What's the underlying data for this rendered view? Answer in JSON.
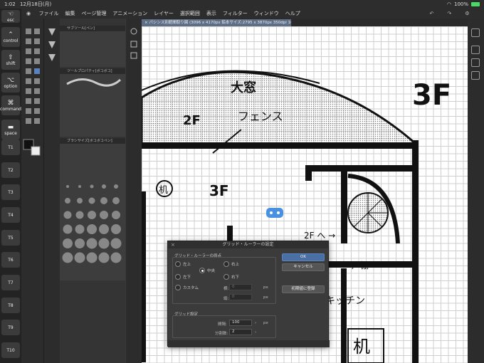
{
  "status_bar": {
    "time": "1:02",
    "date": "12月18日(月)",
    "battery": "100%"
  },
  "menu": {
    "items": [
      "ファイル",
      "編集",
      "ページ管理",
      "アニメーション",
      "レイヤー",
      "選択範囲",
      "表示",
      "フィルター",
      "ウィンドウ",
      "ヘルプ"
    ]
  },
  "left_keys": {
    "esc": "esc",
    "control": "control",
    "shift": "shift",
    "option": "option",
    "command": "command",
    "space": "space",
    "t_keys": [
      "T1",
      "T2",
      "T3",
      "T4",
      "T5",
      "T6",
      "T7",
      "T8",
      "T9",
      "T10"
    ]
  },
  "panels": {
    "subtool": "サブツール[ペン]",
    "tool_property": "ツールプロパティ[ボコボコ]",
    "brush_size": "ブラシサイズ[ボコボコペン]"
  },
  "document_tab": "× パシンス別館間取り図 (3096 x 4170px 鉛本サイズ:2795 x 3870px 350dpi 102.2%)",
  "drawing_text": {
    "floor_big": "3F",
    "dome_label": "大窓",
    "floor_2f": "2F",
    "fence": "フェンス",
    "floor_3f_mid": "3F",
    "desk": "机",
    "to_2f": "2F へ →",
    "shelf": "戸棚",
    "kitchen": "キッチン",
    "desk_bottom": "机"
  },
  "dialog": {
    "title": "グリッド・ルーラーの設定",
    "origin_group": "グリッド・ルーラーの原点",
    "radios": {
      "top_left": "左上",
      "top_right": "右上",
      "center": "中央",
      "bottom_left": "左下",
      "bottom_right": "右下",
      "custom": "カスタム"
    },
    "selected": "center",
    "x_label": "横:",
    "x_value": "0",
    "x_unit": "px",
    "y_label": "縦:",
    "y_value": "0",
    "y_unit": "px",
    "grid_group": "グリッド設定",
    "spacing_label": "間隔:",
    "spacing_value": "100",
    "spacing_unit": "px",
    "divisions_label": "分割数:",
    "divisions_value": "2",
    "ok": "OK",
    "cancel": "キャンセル",
    "register_default": "初期値に登録"
  },
  "colors": {
    "accent": "#4a6fa5",
    "tab": "#5e6e86",
    "panel": "#3b3b3b"
  }
}
